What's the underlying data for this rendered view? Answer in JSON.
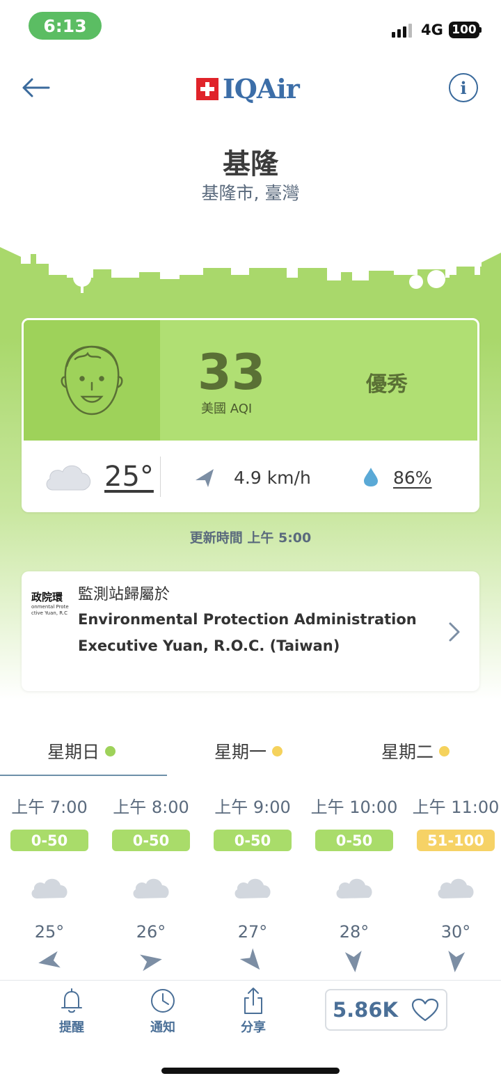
{
  "status_bar": {
    "time": "6:13",
    "network": "4G",
    "battery": "100"
  },
  "header": {
    "logo_text": "IQAir",
    "info_icon_glyph": "i"
  },
  "location": {
    "city": "基隆",
    "region": "基隆市, 臺灣"
  },
  "aqi_card": {
    "aqi": "33",
    "aqi_label": "美國 AQI",
    "level": "優秀",
    "color": "#b0df73",
    "temperature": "25°",
    "wind": "4.9 km/h",
    "humidity": "86%"
  },
  "updated": "更新時間 上午 5:00",
  "station": {
    "label": "監測站歸屬於",
    "name": "Environmental Protection Administration Executive Yuan, R.O.C. (Taiwan)",
    "logo_text": "政院環",
    "logo_subtext_1": "onmental Prote",
    "logo_subtext_2": "ctive Yuan, R.C"
  },
  "day_tabs": [
    {
      "label": "星期日",
      "dot_color": "#9ed25a",
      "active": true
    },
    {
      "label": "星期一",
      "dot_color": "#f5d25c",
      "active": false
    },
    {
      "label": "星期二",
      "dot_color": "#f5d25c",
      "active": false
    }
  ],
  "hourly": [
    {
      "time": "上午 7:00",
      "aqi_range": "0-50",
      "color": "#a9dc6a",
      "temp": "25°",
      "wind_dir": "west",
      "wind_angle": -100
    },
    {
      "time": "上午 8:00",
      "aqi_range": "0-50",
      "color": "#a9dc6a",
      "temp": "26°",
      "wind_dir": "east",
      "wind_angle": 80
    },
    {
      "time": "上午 9:00",
      "aqi_range": "0-50",
      "color": "#a9dc6a",
      "temp": "27°",
      "wind_dir": "south-east",
      "wind_angle": 140
    },
    {
      "time": "上午 10:00",
      "aqi_range": "0-50",
      "color": "#a9dc6a",
      "temp": "28°",
      "wind_dir": "south",
      "wind_angle": 175
    },
    {
      "time": "上午 11:00",
      "aqi_range": "51-100",
      "color": "#f6d266",
      "temp": "30°",
      "wind_dir": "south",
      "wind_angle": 185
    }
  ],
  "bottom_nav": {
    "alerts": "提醒",
    "notifications": "通知",
    "share": "分享",
    "likes": "5.86K"
  }
}
